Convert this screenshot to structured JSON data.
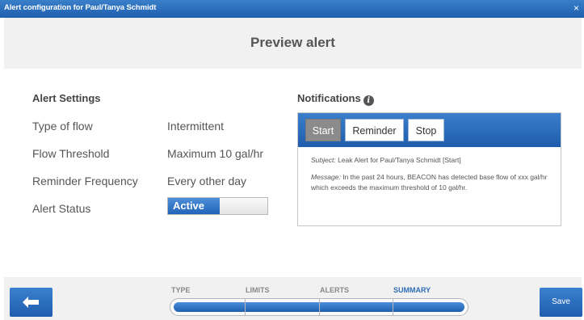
{
  "window": {
    "title": "Alert configuration for Paul/Tanya Schmidt",
    "close_glyph": "×"
  },
  "header": {
    "title": "Preview alert"
  },
  "settings": {
    "title": "Alert Settings",
    "rows": [
      {
        "label": "Type of flow",
        "value": "Intermittent"
      },
      {
        "label": "Flow Threshold",
        "value": "Maximum 10 gal/hr"
      },
      {
        "label": "Reminder Frequency",
        "value": "Every other day"
      },
      {
        "label": "Alert Status",
        "value": "Active"
      }
    ]
  },
  "notifications": {
    "title": "Notifications",
    "info_glyph": "i",
    "tabs": [
      {
        "label": "Start",
        "active": true
      },
      {
        "label": "Reminder",
        "active": false
      },
      {
        "label": "Stop",
        "active": false
      }
    ],
    "subject_label": "Subject:",
    "subject_text": " Leak Alert for Paul/Tanya Schmidt [Start]",
    "message_label": "Message:",
    "message_text": " In the past 24 hours, BEACON has detected base flow of xxx gal/hr which exceeds the maximum threshold of 10 gal/hr."
  },
  "wizard": {
    "steps": [
      "TYPE",
      "LIMITS",
      "ALERTS",
      "SUMMARY"
    ],
    "current_step": "SUMMARY",
    "progress": 1.0,
    "save_label": "Save",
    "back_icon": "arrow-left-icon"
  },
  "colors": {
    "accent": "#2163b7",
    "toggle_on": "#2163b7",
    "active_tab": "#8b8b8b"
  }
}
